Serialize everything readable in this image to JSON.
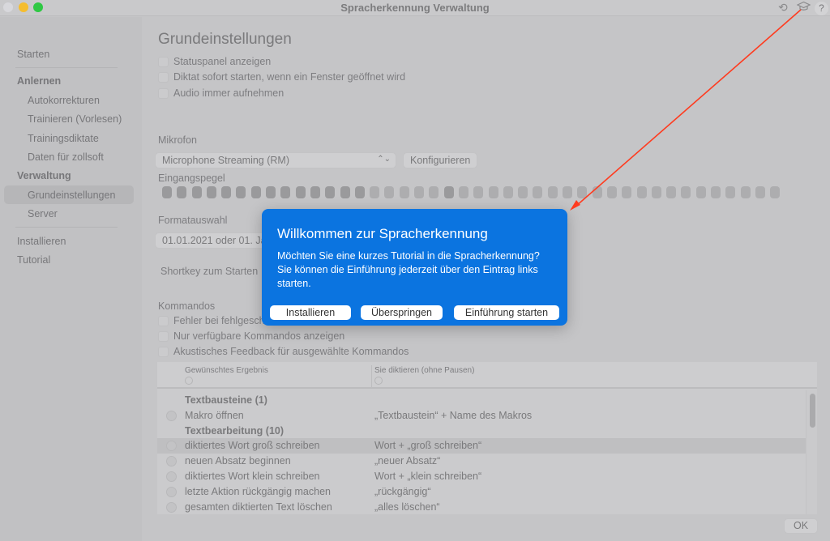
{
  "window": {
    "title": "Spracherkennung Verwaltung"
  },
  "toolbar": {
    "refresh_icon": "refresh-icon",
    "tutorial_icon": "graduation-cap-icon",
    "help_label": "?"
  },
  "sidebar": {
    "items": [
      {
        "label": "Starten"
      },
      {
        "label": "Anlernen"
      },
      {
        "label": "Autokorrekturen"
      },
      {
        "label": "Trainieren (Vorlesen)"
      },
      {
        "label": "Trainingsdiktate"
      },
      {
        "label": "Daten für zollsoft"
      },
      {
        "label": "Verwaltung"
      },
      {
        "label": "Grundeinstellungen",
        "selected": true
      },
      {
        "label": "Server"
      },
      {
        "label": "Installieren"
      },
      {
        "label": "Tutorial"
      }
    ]
  },
  "main": {
    "title": "Grundeinstellungen",
    "general_options": [
      {
        "label": "Statuspanel anzeigen",
        "checked": false
      },
      {
        "label": "Diktat sofort starten, wenn ein Fenster geöffnet wird",
        "checked": false
      },
      {
        "label": "Audio immer aufnehmen",
        "checked": false
      }
    ],
    "mikrofon_label": "Mikrofon",
    "mikrofon_value": "Microphone Streaming (RM)",
    "configure_button": "Konfigurieren",
    "eingangspegel_label": "Eingangspegel",
    "input_level": {
      "total_segments": 42,
      "active_segments": 14,
      "peak_segment": 20
    },
    "format_label": "Formatauswahl",
    "format_value": "01.01.2021 oder 01. Ja",
    "shortkey_label": "Shortkey zum Starten",
    "kommandos_label": "Kommandos",
    "command_options": [
      {
        "label": "Fehler bei fehlgesch",
        "checked": false
      },
      {
        "label": "Nur verfügbare Kommandos anzeigen",
        "checked": false
      },
      {
        "label": "Akustisches Feedback für ausgewählte Kommandos",
        "checked": false
      }
    ],
    "table": {
      "columns": [
        "Gewünschtes Ergebnis",
        "Sie diktieren (ohne Pausen)"
      ],
      "rows": [
        {
          "group": true,
          "result": "Textbausteine (1)",
          "dictate": ""
        },
        {
          "group": false,
          "result": "Makro öffnen",
          "dictate": "„Textbaustein“ + Name des Makros"
        },
        {
          "group": true,
          "result": "Textbearbeitung (10)",
          "dictate": ""
        },
        {
          "group": false,
          "result": "diktiertes Wort groß schreiben",
          "dictate": "Wort + „groß schreiben“",
          "selected": true
        },
        {
          "group": false,
          "result": "neuen Absatz beginnen",
          "dictate": "„neuer Absatz“"
        },
        {
          "group": false,
          "result": "diktiertes Wort klein schreiben",
          "dictate": "Wort + „klein schreiben“"
        },
        {
          "group": false,
          "result": "letzte Aktion rückgängig machen",
          "dictate": "„rückgängig“"
        },
        {
          "group": false,
          "result": "gesamten diktierten Text löschen",
          "dictate": "„alles löschen“"
        }
      ]
    },
    "ok_button": "OK"
  },
  "dialog": {
    "title": "Willkommen zur Spracherkennung",
    "body": "Möchten Sie eine kurzes Tutorial in die Spracherkennung? Sie können die Einführung jederzeit über den Eintrag links starten.",
    "buttons": [
      "Installieren",
      "Überspringen",
      "Einführung starten"
    ],
    "color": "#0b74e0"
  },
  "annotation": {
    "arrow_color": "#ff3b1f"
  }
}
